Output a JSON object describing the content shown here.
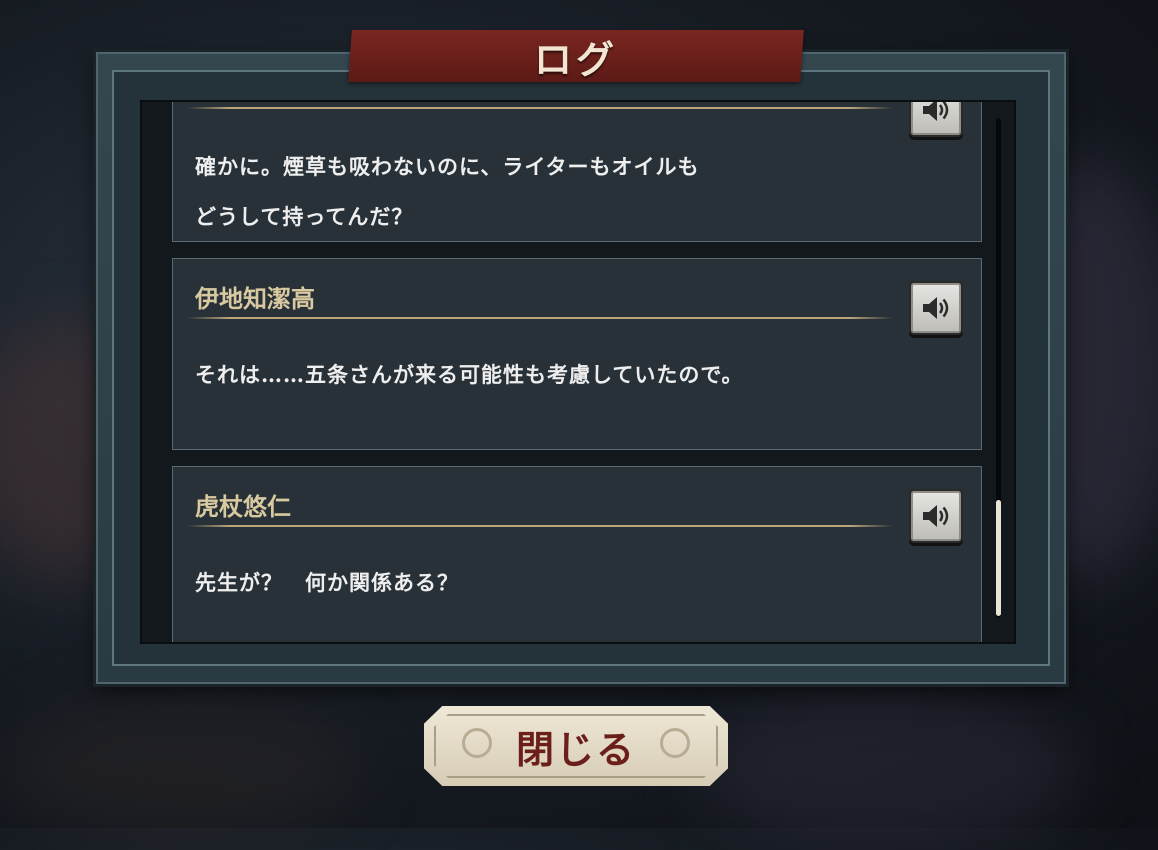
{
  "title": "ログ",
  "entries": [
    {
      "speaker": "",
      "lines": [
        "確かに。煙草も吸わないのに、ライターもオイルも",
        "どうして持ってんだ？"
      ]
    },
    {
      "speaker": "伊地知潔高",
      "lines": [
        "それは……五条さんが来る可能性も考慮していたので。"
      ]
    },
    {
      "speaker": "虎杖悠仁",
      "lines": [
        "先生が？　何か関係ある？"
      ]
    }
  ],
  "close_button": {
    "label": "閉じる"
  },
  "icons": {
    "voice": "speaker-icon"
  },
  "colors": {
    "banner": "#6e221c",
    "speaker_name": "#d8c9a0",
    "close_text": "#6b1f1a"
  }
}
